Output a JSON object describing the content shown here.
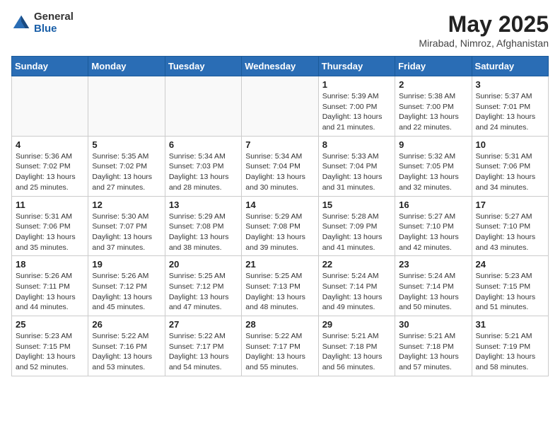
{
  "header": {
    "logo_general": "General",
    "logo_blue": "Blue",
    "month_year": "May 2025",
    "location": "Mirabad, Nimroz, Afghanistan"
  },
  "days_of_week": [
    "Sunday",
    "Monday",
    "Tuesday",
    "Wednesday",
    "Thursday",
    "Friday",
    "Saturday"
  ],
  "weeks": [
    [
      {
        "day": "",
        "detail": ""
      },
      {
        "day": "",
        "detail": ""
      },
      {
        "day": "",
        "detail": ""
      },
      {
        "day": "",
        "detail": ""
      },
      {
        "day": "1",
        "detail": "Sunrise: 5:39 AM\nSunset: 7:00 PM\nDaylight: 13 hours\nand 21 minutes."
      },
      {
        "day": "2",
        "detail": "Sunrise: 5:38 AM\nSunset: 7:00 PM\nDaylight: 13 hours\nand 22 minutes."
      },
      {
        "day": "3",
        "detail": "Sunrise: 5:37 AM\nSunset: 7:01 PM\nDaylight: 13 hours\nand 24 minutes."
      }
    ],
    [
      {
        "day": "4",
        "detail": "Sunrise: 5:36 AM\nSunset: 7:02 PM\nDaylight: 13 hours\nand 25 minutes."
      },
      {
        "day": "5",
        "detail": "Sunrise: 5:35 AM\nSunset: 7:02 PM\nDaylight: 13 hours\nand 27 minutes."
      },
      {
        "day": "6",
        "detail": "Sunrise: 5:34 AM\nSunset: 7:03 PM\nDaylight: 13 hours\nand 28 minutes."
      },
      {
        "day": "7",
        "detail": "Sunrise: 5:34 AM\nSunset: 7:04 PM\nDaylight: 13 hours\nand 30 minutes."
      },
      {
        "day": "8",
        "detail": "Sunrise: 5:33 AM\nSunset: 7:04 PM\nDaylight: 13 hours\nand 31 minutes."
      },
      {
        "day": "9",
        "detail": "Sunrise: 5:32 AM\nSunset: 7:05 PM\nDaylight: 13 hours\nand 32 minutes."
      },
      {
        "day": "10",
        "detail": "Sunrise: 5:31 AM\nSunset: 7:06 PM\nDaylight: 13 hours\nand 34 minutes."
      }
    ],
    [
      {
        "day": "11",
        "detail": "Sunrise: 5:31 AM\nSunset: 7:06 PM\nDaylight: 13 hours\nand 35 minutes."
      },
      {
        "day": "12",
        "detail": "Sunrise: 5:30 AM\nSunset: 7:07 PM\nDaylight: 13 hours\nand 37 minutes."
      },
      {
        "day": "13",
        "detail": "Sunrise: 5:29 AM\nSunset: 7:08 PM\nDaylight: 13 hours\nand 38 minutes."
      },
      {
        "day": "14",
        "detail": "Sunrise: 5:29 AM\nSunset: 7:08 PM\nDaylight: 13 hours\nand 39 minutes."
      },
      {
        "day": "15",
        "detail": "Sunrise: 5:28 AM\nSunset: 7:09 PM\nDaylight: 13 hours\nand 41 minutes."
      },
      {
        "day": "16",
        "detail": "Sunrise: 5:27 AM\nSunset: 7:10 PM\nDaylight: 13 hours\nand 42 minutes."
      },
      {
        "day": "17",
        "detail": "Sunrise: 5:27 AM\nSunset: 7:10 PM\nDaylight: 13 hours\nand 43 minutes."
      }
    ],
    [
      {
        "day": "18",
        "detail": "Sunrise: 5:26 AM\nSunset: 7:11 PM\nDaylight: 13 hours\nand 44 minutes."
      },
      {
        "day": "19",
        "detail": "Sunrise: 5:26 AM\nSunset: 7:12 PM\nDaylight: 13 hours\nand 45 minutes."
      },
      {
        "day": "20",
        "detail": "Sunrise: 5:25 AM\nSunset: 7:12 PM\nDaylight: 13 hours\nand 47 minutes."
      },
      {
        "day": "21",
        "detail": "Sunrise: 5:25 AM\nSunset: 7:13 PM\nDaylight: 13 hours\nand 48 minutes."
      },
      {
        "day": "22",
        "detail": "Sunrise: 5:24 AM\nSunset: 7:14 PM\nDaylight: 13 hours\nand 49 minutes."
      },
      {
        "day": "23",
        "detail": "Sunrise: 5:24 AM\nSunset: 7:14 PM\nDaylight: 13 hours\nand 50 minutes."
      },
      {
        "day": "24",
        "detail": "Sunrise: 5:23 AM\nSunset: 7:15 PM\nDaylight: 13 hours\nand 51 minutes."
      }
    ],
    [
      {
        "day": "25",
        "detail": "Sunrise: 5:23 AM\nSunset: 7:15 PM\nDaylight: 13 hours\nand 52 minutes."
      },
      {
        "day": "26",
        "detail": "Sunrise: 5:22 AM\nSunset: 7:16 PM\nDaylight: 13 hours\nand 53 minutes."
      },
      {
        "day": "27",
        "detail": "Sunrise: 5:22 AM\nSunset: 7:17 PM\nDaylight: 13 hours\nand 54 minutes."
      },
      {
        "day": "28",
        "detail": "Sunrise: 5:22 AM\nSunset: 7:17 PM\nDaylight: 13 hours\nand 55 minutes."
      },
      {
        "day": "29",
        "detail": "Sunrise: 5:21 AM\nSunset: 7:18 PM\nDaylight: 13 hours\nand 56 minutes."
      },
      {
        "day": "30",
        "detail": "Sunrise: 5:21 AM\nSunset: 7:18 PM\nDaylight: 13 hours\nand 57 minutes."
      },
      {
        "day": "31",
        "detail": "Sunrise: 5:21 AM\nSunset: 7:19 PM\nDaylight: 13 hours\nand 58 minutes."
      }
    ]
  ]
}
